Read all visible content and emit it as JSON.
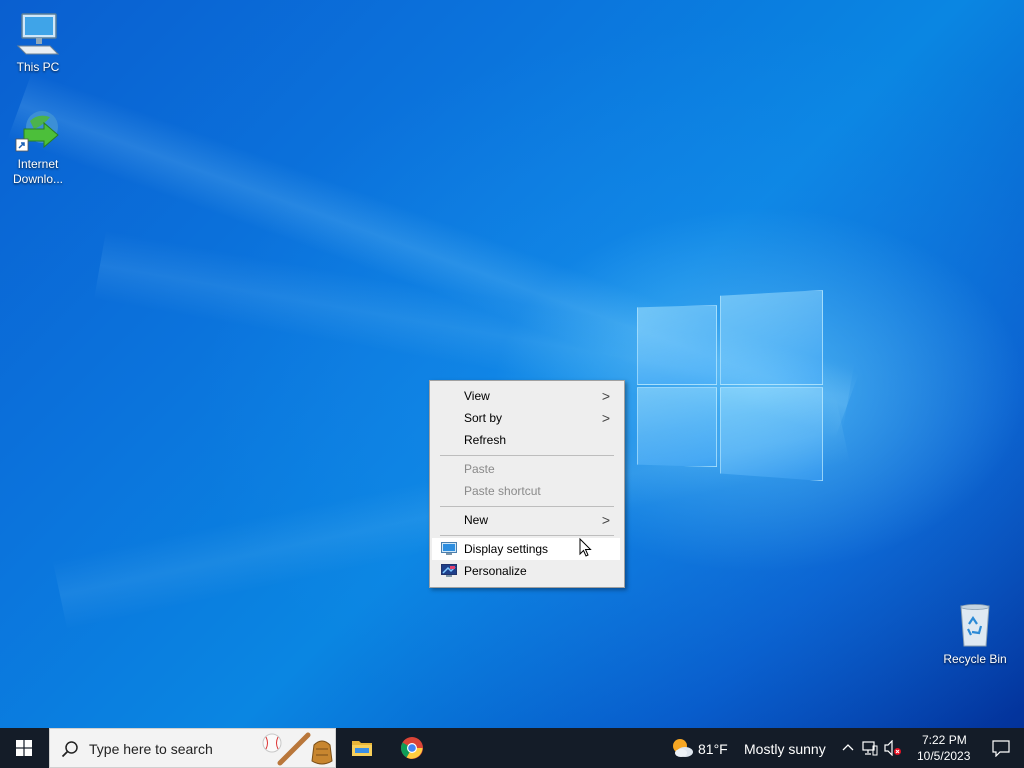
{
  "desktop_icons": {
    "this_pc": "This PC",
    "idm_line1": "Internet",
    "idm_line2": "Downlo...",
    "recycle_bin": "Recycle Bin"
  },
  "context_menu": {
    "view": "View",
    "sort_by": "Sort by",
    "refresh": "Refresh",
    "paste": "Paste",
    "paste_shortcut": "Paste shortcut",
    "new": "New",
    "display_settings": "Display settings",
    "personalize": "Personalize",
    "submenu_arrow": ">"
  },
  "taskbar": {
    "search_placeholder": "Type here to search",
    "weather_temp": "81°F",
    "weather_text": "Mostly sunny",
    "time": "7:22 PM",
    "date": "10/5/2023"
  },
  "colors": {
    "accent": "#0a78d7",
    "taskbar": "#141c28",
    "menu_bg": "#eeeeee"
  }
}
